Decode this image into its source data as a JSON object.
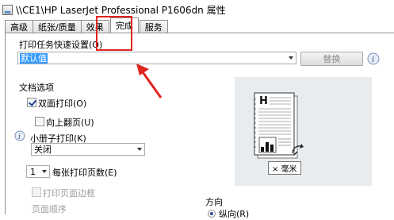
{
  "window": {
    "title": "\\\\CE1\\HP LaserJet Professional P1606dn 属性"
  },
  "tabs": [
    {
      "label": "高级"
    },
    {
      "label": "纸张/质量"
    },
    {
      "label": "效果"
    },
    {
      "label": "完成",
      "active": true
    },
    {
      "label": "服务"
    }
  ],
  "presets": {
    "label": "打印任务快速设置(Q)",
    "value": "默认值",
    "save_button": "替换"
  },
  "document_options": {
    "group_label": "文档选项",
    "duplex": {
      "label": "双面打印(O)",
      "checked": true
    },
    "flip_pages_up": {
      "label": "向上翻页(U)",
      "checked": false
    },
    "booklet": {
      "label": "小册子打印(K)",
      "value": "关闭"
    },
    "pages_per_sheet": {
      "label": "每张打印页数(E)",
      "value": "1"
    },
    "print_page_borders": {
      "label": "打印页面边框",
      "checked": false
    },
    "page_order": {
      "label": "页面顺序"
    }
  },
  "preview": {
    "paper_size": "× 毫米"
  },
  "orientation": {
    "group_label": "方向",
    "portrait": "纵向(R)"
  },
  "colors": {
    "annotation": "#e0241f",
    "selection": "#3399ff"
  }
}
